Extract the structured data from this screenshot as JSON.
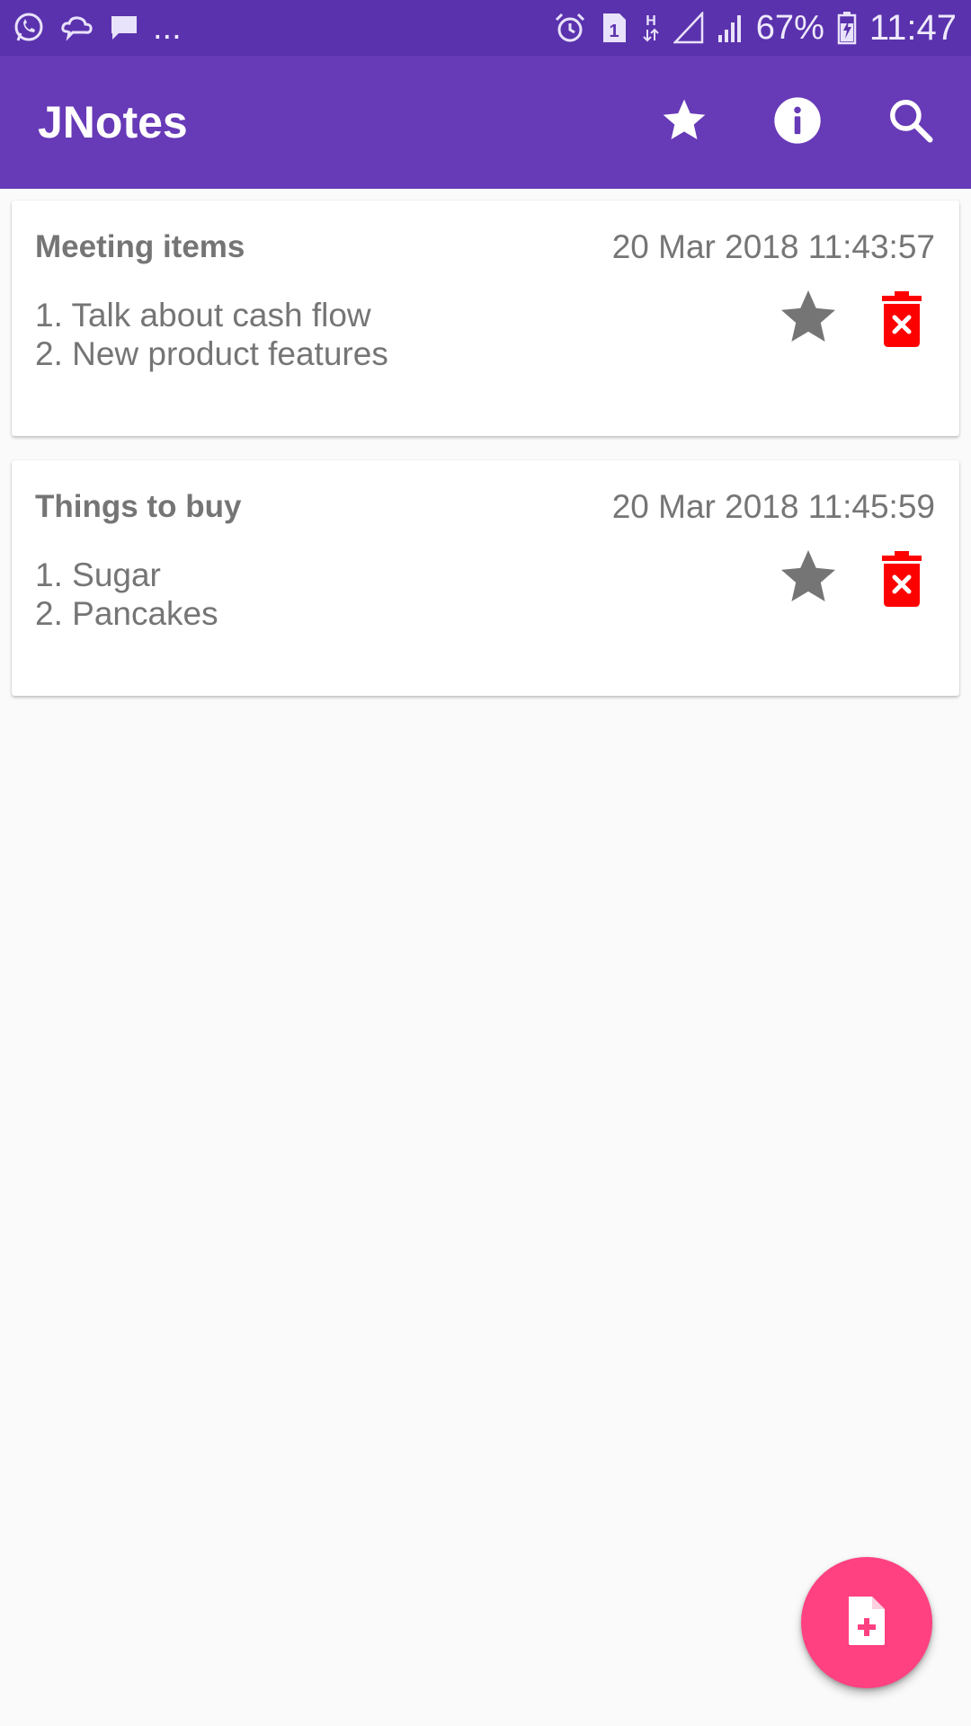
{
  "status_bar": {
    "left_icons": [
      "whatsapp-icon",
      "cloud-chat-icon",
      "message-icon"
    ],
    "overflow_text": "...",
    "right_icons": [
      "alarm-icon",
      "sim-1-icon",
      "h-data-icon",
      "signal-icon",
      "signal-icon",
      "battery-charging-icon"
    ],
    "battery_text": "67%",
    "time": "11:47"
  },
  "app_bar": {
    "title": "JNotes",
    "actions": [
      "star-icon",
      "info-icon",
      "search-icon"
    ]
  },
  "notes": [
    {
      "title": "Meeting items",
      "date": "20 Mar 2018 11:43:57",
      "lines": [
        "1. Talk about cash flow",
        "2. New product features"
      ]
    },
    {
      "title": "Things to buy",
      "date": "20 Mar 2018 11:45:59",
      "lines": [
        "1. Sugar",
        "2. Pancakes"
      ]
    }
  ],
  "fab": {
    "icon": "add-note-icon"
  },
  "colors": {
    "status_bar": "#5a32ad",
    "app_bar": "#673ab7",
    "fab": "#ff4081",
    "delete": "#ff0000",
    "text": "#757575"
  }
}
